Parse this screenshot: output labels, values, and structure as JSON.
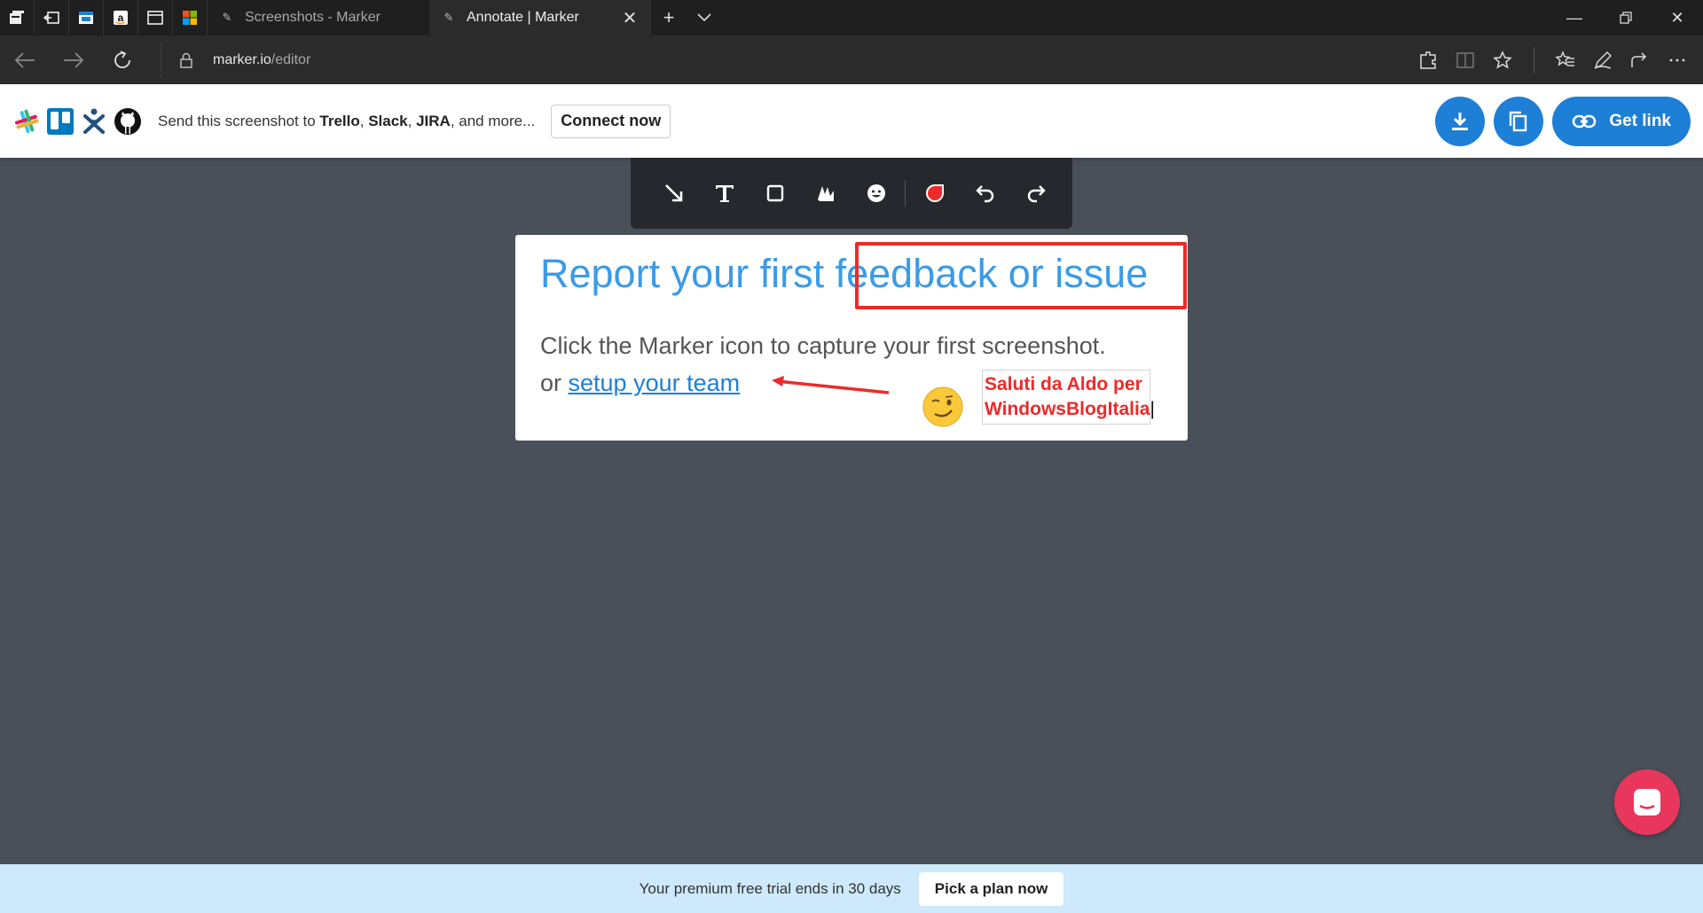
{
  "browser": {
    "tabs": [
      {
        "label": "Screenshots - Marker",
        "active": false
      },
      {
        "label": "Annotate | Marker",
        "active": true
      }
    ],
    "address": {
      "host": "marker.io",
      "path": "/editor"
    },
    "pinned_icons": [
      "tab-manager-icon",
      "set-aside-icon",
      "mail-app-icon",
      "amazon-icon",
      "window-icon",
      "microsoft-store-icon"
    ]
  },
  "marker_bar": {
    "send_prefix": "Send this screenshot to ",
    "trello": "Trello",
    "comma1": ", ",
    "slack": "Slack",
    "comma2": ", ",
    "jira": "JIRA",
    "suffix": ", and more...",
    "connect_label": "Connect now",
    "get_link_label": "Get link"
  },
  "card": {
    "title_part1": "Report your first ",
    "title_part2": "feedback or issue",
    "line1": "Click the Marker icon to capture your first screenshot.",
    "line2_prefix": "or ",
    "line2_link": "setup your team",
    "annotation_text_line1": "Saluti da Aldo per",
    "annotation_text_line2": "WindowsBlogItalia"
  },
  "banner": {
    "text": "Your premium free trial ends in 30 days",
    "button_label": "Pick a plan now"
  },
  "colors": {
    "accent": "#1e7fd6",
    "annotation": "#ee2a2a",
    "title_blue": "#3b9be6",
    "chat": "#e8365d"
  }
}
